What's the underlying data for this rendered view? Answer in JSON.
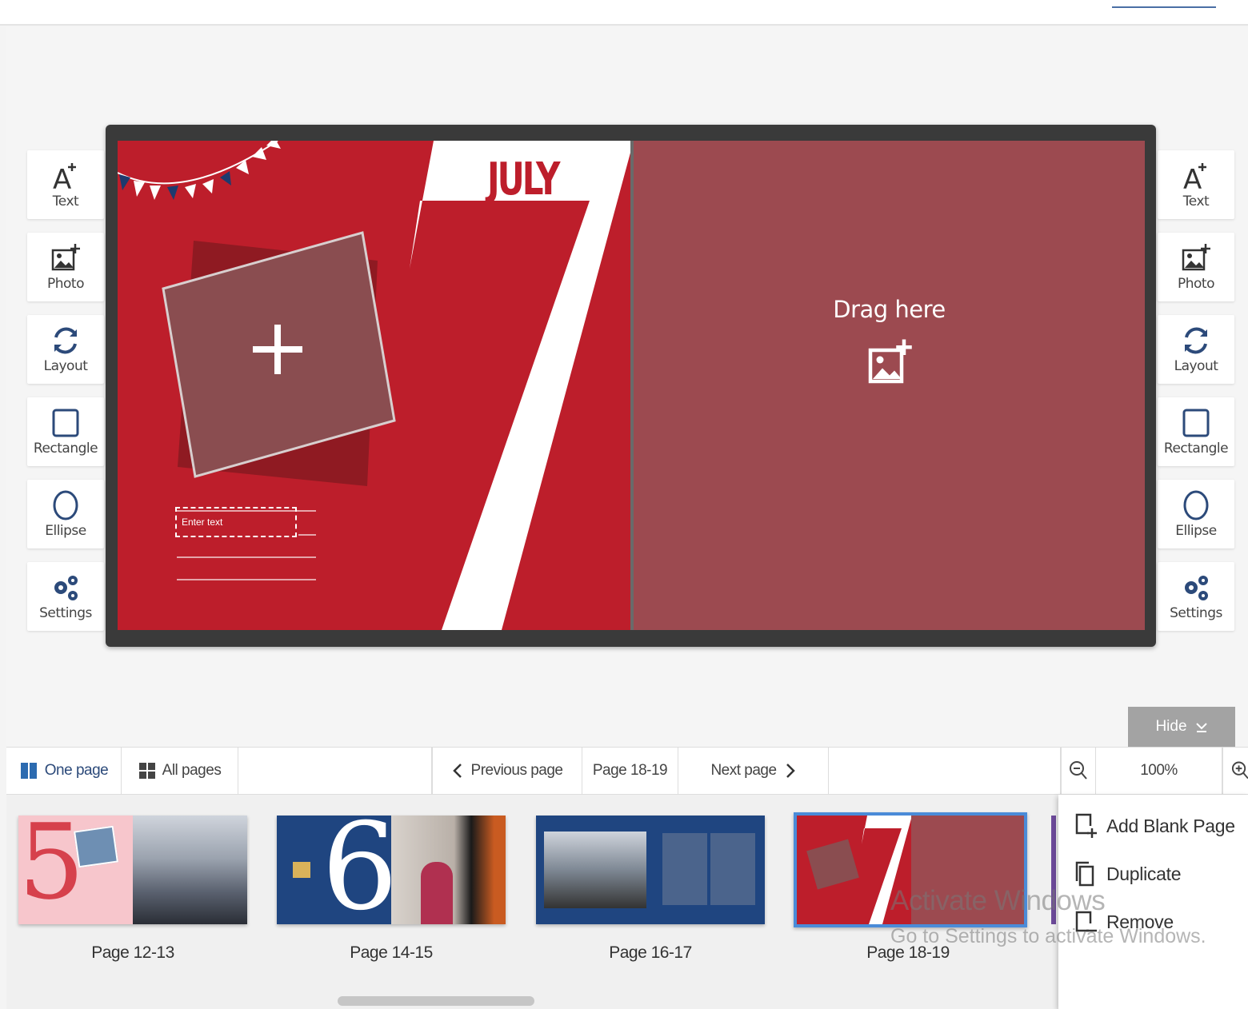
{
  "tools": {
    "left": [
      {
        "icon": "text-add-icon",
        "label": "Text"
      },
      {
        "icon": "photo-add-icon",
        "label": "Photo"
      },
      {
        "icon": "layout-icon",
        "label": "Layout"
      },
      {
        "icon": "rectangle-icon",
        "label": "Rectangle"
      },
      {
        "icon": "ellipse-icon",
        "label": "Ellipse"
      },
      {
        "icon": "settings-icon",
        "label": "Settings"
      }
    ],
    "right": [
      {
        "icon": "text-add-icon",
        "label": "Text"
      },
      {
        "icon": "photo-add-icon",
        "label": "Photo"
      },
      {
        "icon": "layout-icon",
        "label": "Layout"
      },
      {
        "icon": "rectangle-icon",
        "label": "Rectangle"
      },
      {
        "icon": "ellipse-icon",
        "label": "Ellipse"
      },
      {
        "icon": "settings-icon",
        "label": "Settings"
      }
    ]
  },
  "spread": {
    "month": "JULY",
    "big_number": "7",
    "text_placeholder": "Enter text",
    "drop_zone": "Drag here",
    "colors": {
      "left_bg": "#bd1e2b",
      "right_bg": "#9c4a50",
      "frame": "#3a3a3a"
    }
  },
  "hide_label": "Hide",
  "nav": {
    "one_page": "One page",
    "all_pages": "All pages",
    "previous": "Previous page",
    "current": "Page 18-19",
    "next": "Next page",
    "zoom": "100%"
  },
  "thumbnails": [
    {
      "label": "Page 12-13",
      "number": "5",
      "selected": false
    },
    {
      "label": "Page 14-15",
      "number": "6",
      "selected": false
    },
    {
      "label": "Page 16-17",
      "number": "",
      "selected": false
    },
    {
      "label": "Page 18-19",
      "number": "7",
      "selected": true
    }
  ],
  "context_menu": {
    "add_blank": "Add Blank Page",
    "duplicate": "Duplicate",
    "remove": "Remove"
  },
  "watermark": {
    "title": "Activate Windows",
    "subtitle": "Go to Settings to activate Windows."
  }
}
